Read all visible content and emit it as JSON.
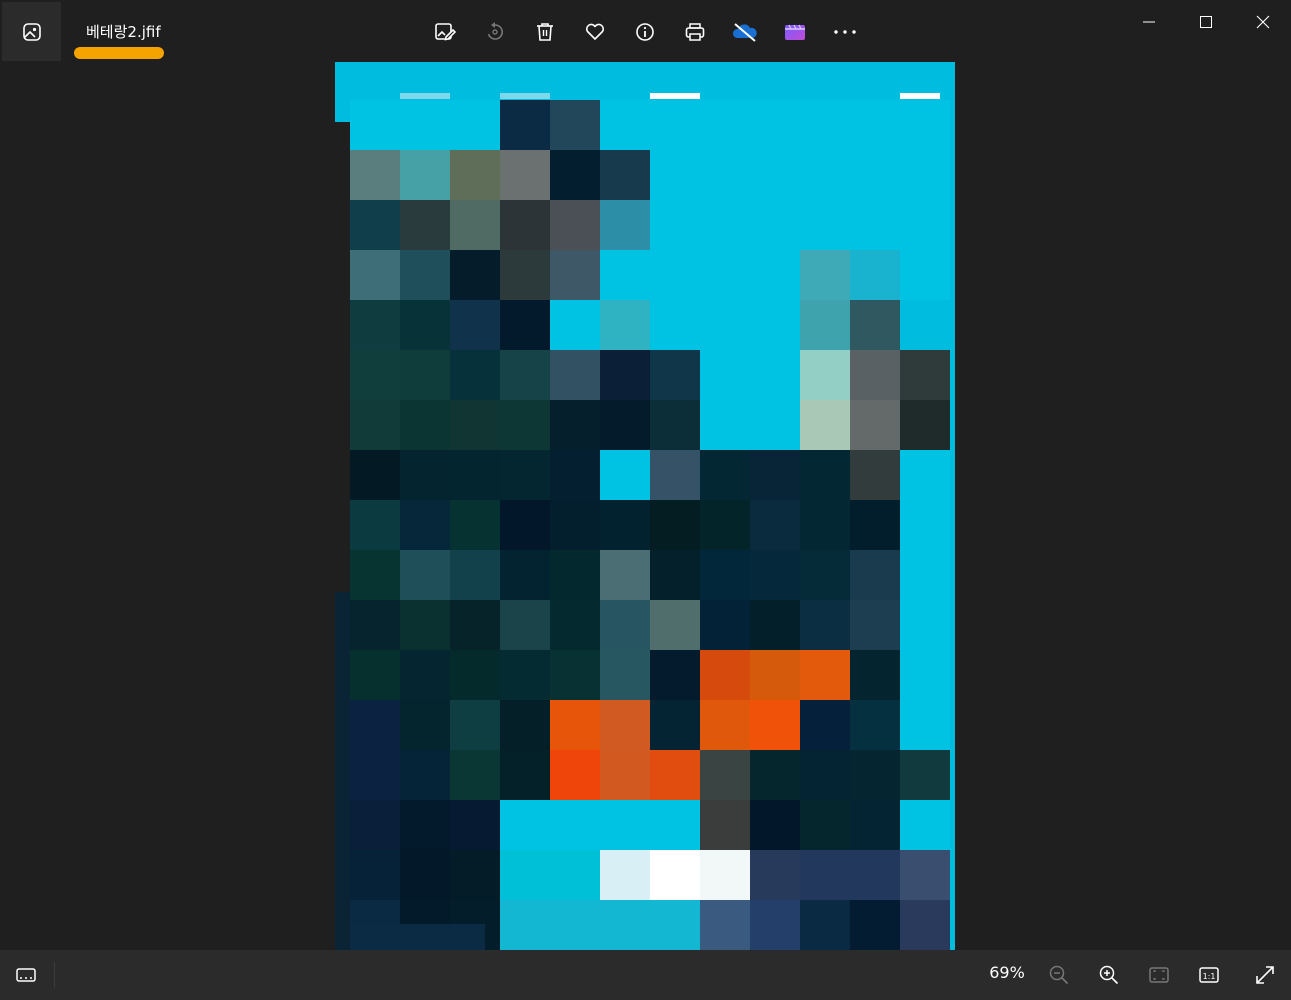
{
  "app": {
    "file_name": "베테랑2.jfif"
  },
  "toolbar": {
    "items": [
      {
        "name": "edit-image-icon",
        "tooltip": "Edit image"
      },
      {
        "name": "rotate-icon",
        "tooltip": "Rotate"
      },
      {
        "name": "delete-icon",
        "tooltip": "Delete"
      },
      {
        "name": "favorite-heart-icon",
        "tooltip": "Favorite"
      },
      {
        "name": "info-icon",
        "tooltip": "File information"
      },
      {
        "name": "print-icon",
        "tooltip": "Print"
      },
      {
        "name": "onedrive-off-icon",
        "tooltip": "OneDrive"
      },
      {
        "name": "clipchamp-icon",
        "tooltip": "Clipchamp"
      },
      {
        "name": "more-options-icon",
        "tooltip": "See more"
      }
    ]
  },
  "window_controls": [
    "minimize-icon",
    "maximize-icon",
    "close-icon"
  ],
  "bottom_bar": {
    "zoom_level": "69%",
    "one_to_one_label": "1:1"
  },
  "colors": {
    "background": "#1f1f1f",
    "bar": "#2b2b2b",
    "accent_underline": "#f5a300",
    "photo_cyan": "#00bde0"
  }
}
